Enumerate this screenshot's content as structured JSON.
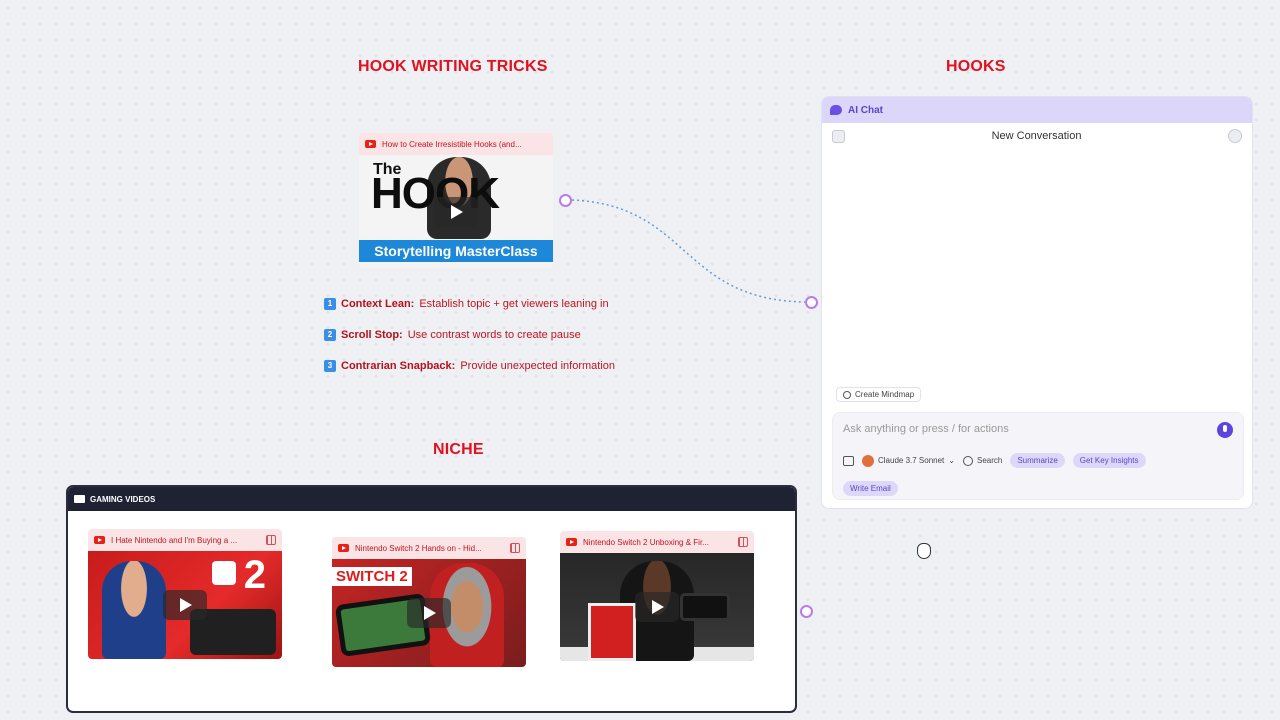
{
  "sections": {
    "hook_tricks_title": "HOOK WRITING TRICKS",
    "hooks_title": "HOOKS",
    "niche_title": "NICHE"
  },
  "hook_video": {
    "title": "How to Create Irresistible Hooks (and...",
    "thumb_top": "The",
    "thumb_big": "HOOK",
    "thumb_banner": "Storytelling MasterClass",
    "play_icon": "play-icon"
  },
  "steps": [
    {
      "num": "1",
      "key": "Context Lean:",
      "text": "Establish topic + get viewers leaning in"
    },
    {
      "num": "2",
      "key": "Scroll Stop:",
      "text": "Use contrast words to create pause"
    },
    {
      "num": "3",
      "key": "Contrarian Snapback:",
      "text": "Provide unexpected information"
    }
  ],
  "ai_chat": {
    "header": "AI Chat",
    "conversation_title": "New Conversation",
    "mindmap_label": "Create Mindmap",
    "input_placeholder": "Ask anything or press / for actions",
    "model": "Claude 3.7 Sonnet",
    "search_label": "Search",
    "chips": [
      "Summarize",
      "Get Key Insights",
      "Write Email"
    ]
  },
  "folder": {
    "title": "GAMING VIDEOS",
    "videos": [
      {
        "title": "I Hate Nintendo and I'm Buying a ...",
        "thumb_text": "2"
      },
      {
        "title": "Nintendo Switch 2 Hands on - Hid...",
        "thumb_text": "SWITCH 2"
      },
      {
        "title": "Nintendo Switch 2 Unboxing & Fir...",
        "thumb_text": ""
      }
    ]
  },
  "colors": {
    "accent_red": "#e3101e",
    "chat_purple": "#dcd7fa",
    "connector": "#b97be8"
  }
}
